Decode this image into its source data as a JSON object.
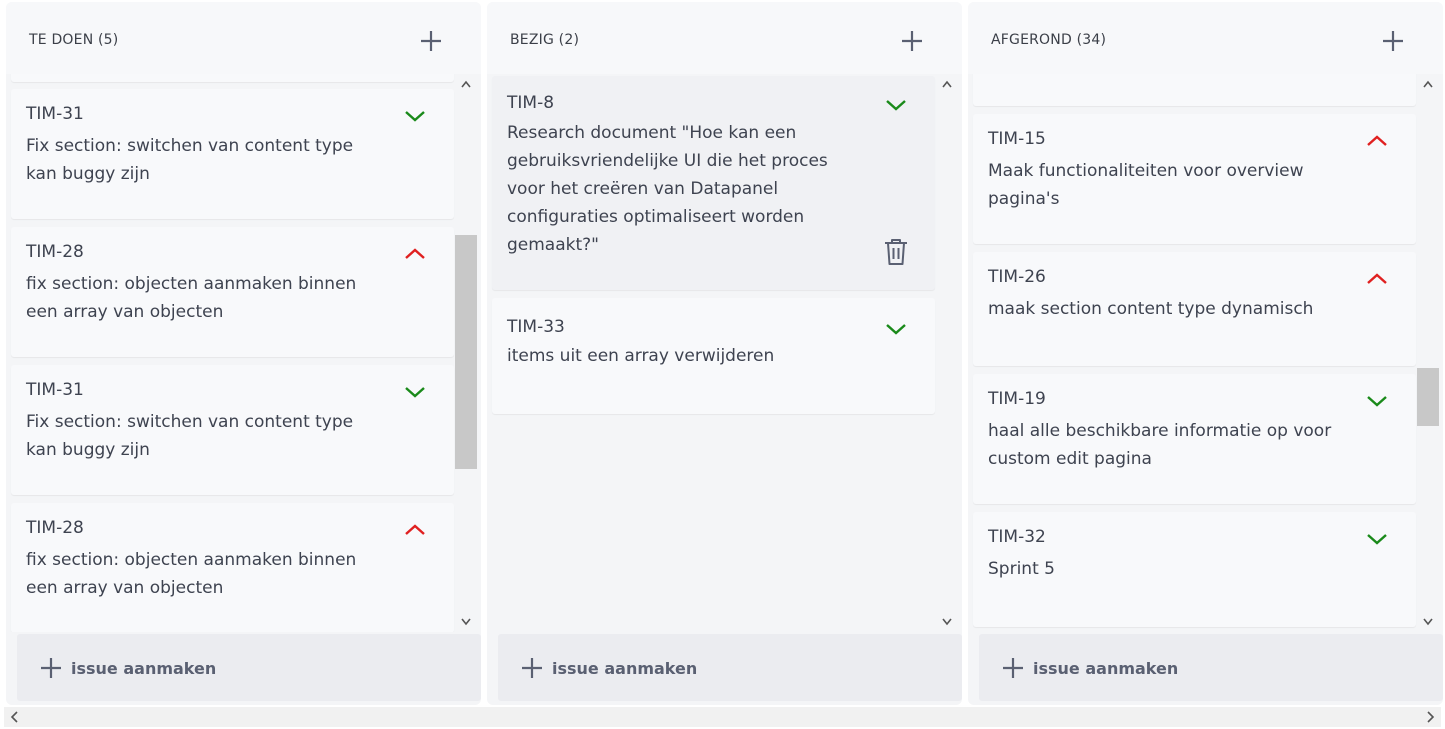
{
  "columns": [
    {
      "title": "TE DOEN (5)",
      "cards": [
        {
          "key": "TIM-31",
          "title": "Fix section: switchen van content type kan buggy zijn",
          "priority": "low"
        },
        {
          "key": "TIM-28",
          "title": "fix section: objecten aanmaken binnen een array van objecten",
          "priority": "high"
        },
        {
          "key": "TIM-31",
          "title": "Fix section: switchen van content type kan buggy zijn",
          "priority": "low"
        },
        {
          "key": "TIM-28",
          "title": "fix section: objecten aanmaken binnen een array van objecten",
          "priority": "high"
        }
      ],
      "create_label": "issue aanmaken"
    },
    {
      "title": "BEZIG (2)",
      "cards": [
        {
          "key": "TIM-8",
          "title": "Research document \"Hoe kan een gebruiksvriendelijke UI die het proces voor het creëren van Datapanel configuraties optimaliseert worden gemaakt?\"",
          "priority": "low"
        },
        {
          "key": "TIM-33",
          "title": "items uit een array verwijderen",
          "priority": "low"
        }
      ],
      "create_label": "issue aanmaken"
    },
    {
      "title": "AFGEROND (34)",
      "cards": [
        {
          "key": "TIM-15",
          "title": "Maak functionaliteiten voor overview pagina's",
          "priority": "high"
        },
        {
          "key": "TIM-26",
          "title": "maak section content type dynamisch",
          "priority": "high"
        },
        {
          "key": "TIM-19",
          "title": "haal alle beschikbare informatie op voor custom edit pagina",
          "priority": "low"
        },
        {
          "key": "TIM-32",
          "title": "Sprint 5",
          "priority": "low"
        }
      ],
      "create_label": "issue aanmaken"
    }
  ],
  "colors": {
    "priority_low": "#1a8a1a",
    "priority_high": "#e02020",
    "icon_gray": "#5a6072"
  },
  "icons": {
    "add": "plus-icon",
    "priority_low": "chevron-down-icon",
    "priority_high": "chevron-up-icon",
    "delete": "trash-icon"
  }
}
